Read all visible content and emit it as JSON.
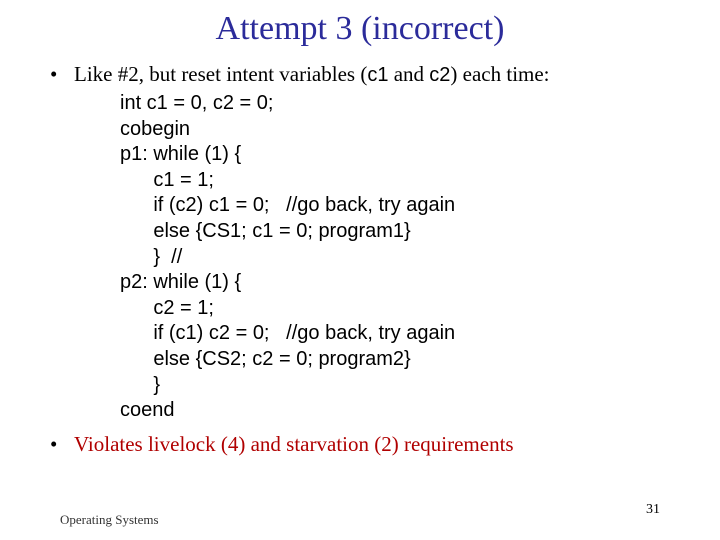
{
  "title": "Attempt 3 (incorrect)",
  "bullet1": {
    "pre": "Like #2, but reset intent variables (",
    "v1": "c1",
    "mid": " and ",
    "v2": "c2",
    "post": ") each time:"
  },
  "code": {
    "l0": "int c1 = 0, c2 = 0;",
    "l1": "cobegin",
    "l2": "p1: while (1) {",
    "l3": "      c1 = 1;",
    "l4": "      if (c2) c1 = 0;   //go back, try again",
    "l5": "      else {CS1; c1 = 0; program1}",
    "l6": "      }  //",
    "l7": "p2: while (1) {",
    "l8": "      c2 = 1;",
    "l9": "      if (c1) c2 = 0;   //go back, try again",
    "l10": "      else {CS2; c2 = 0; program2}",
    "l11": "      }",
    "l12": "coend"
  },
  "bullet2": "Violates livelock (4) and starvation (2) requirements",
  "footer": "Operating Systems",
  "page": "31"
}
